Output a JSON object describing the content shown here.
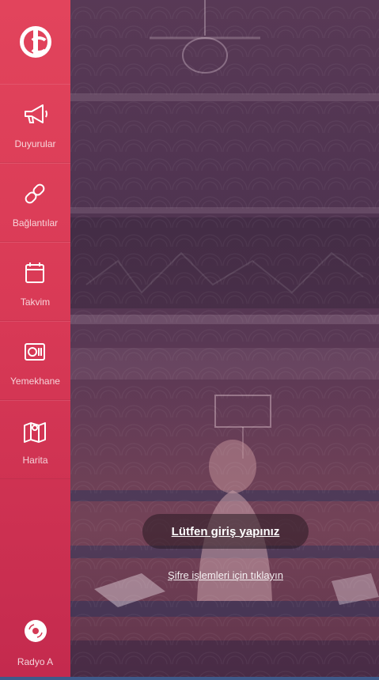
{
  "sidebar": {
    "logo_icon": "university-logo-icon",
    "items": [
      {
        "label": "Duyurular",
        "icon": "megaphone-icon"
      },
      {
        "label": "Bağlantılar",
        "icon": "link-icon"
      },
      {
        "label": "Takvim",
        "icon": "calendar-icon"
      },
      {
        "label": "Yemekhane",
        "icon": "food-tray-icon"
      },
      {
        "label": "Harita",
        "icon": "map-icon"
      }
    ],
    "radio": {
      "label": "Radyo A",
      "icon": "radio-disc-icon"
    }
  },
  "login": {
    "button_label": "Lütfen giriş yapınız",
    "password_link": "Şifre işlemleri için tıklayın"
  },
  "colors": {
    "sidebar_top": "#e2445c",
    "sidebar_bottom": "#c42a4e",
    "background_overlay": "#4f3a55",
    "bottom_bar": "#3f5a8a"
  }
}
